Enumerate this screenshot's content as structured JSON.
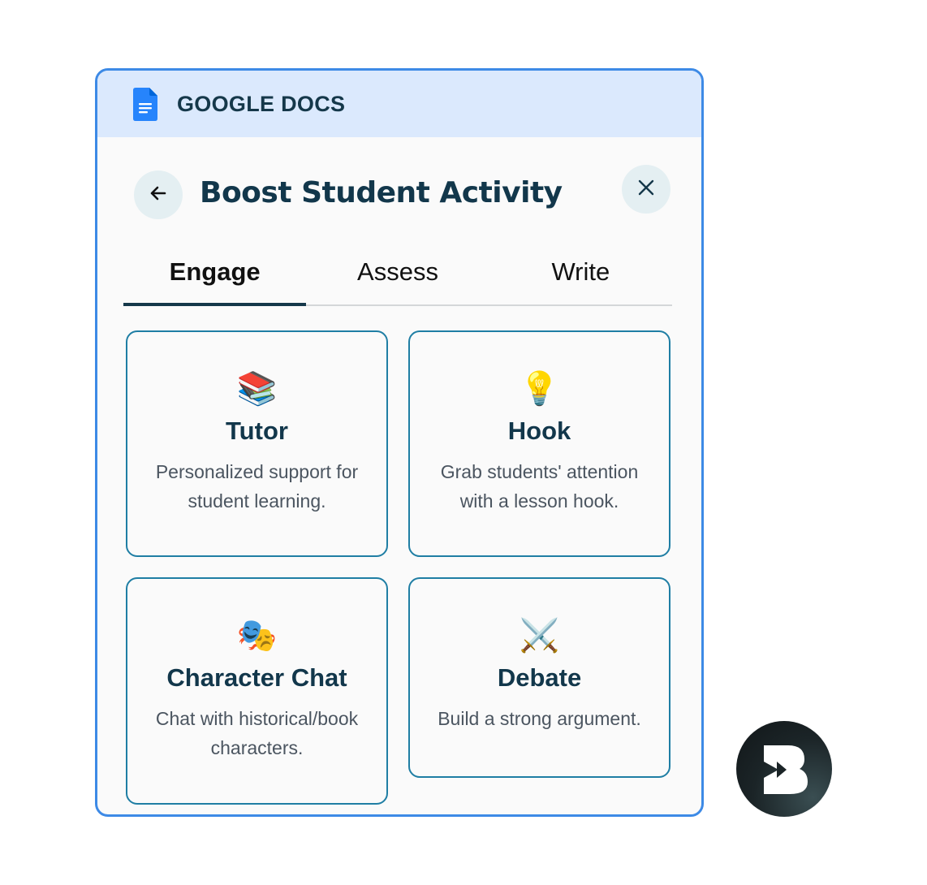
{
  "app": {
    "name": "GOOGLE DOCS",
    "icon": "google-docs-icon",
    "accent_color": "#3d8ae6",
    "header_bg": "#dbe9fd"
  },
  "page": {
    "title": "Boost Student Activity",
    "back_icon": "arrow-left-icon",
    "close_icon": "close-icon"
  },
  "tabs": [
    {
      "label": "Engage",
      "active": true
    },
    {
      "label": "Assess",
      "active": false
    },
    {
      "label": "Write",
      "active": false
    }
  ],
  "cards": [
    {
      "emoji": "📚",
      "icon": "books-icon",
      "title": "Tutor",
      "description": "Personalized support for student learning."
    },
    {
      "emoji": "💡",
      "icon": "lightbulb-icon",
      "title": "Hook",
      "description": "Grab students' attention with a lesson hook."
    },
    {
      "emoji": "🎭",
      "icon": "theater-masks-icon",
      "title": "Character Chat",
      "description": "Chat with historical/book characters."
    },
    {
      "emoji": "⚔️",
      "icon": "crossed-swords-icon",
      "title": "Debate",
      "description": "Build a strong argument."
    }
  ],
  "brand": {
    "icon": "brand-b-logo-icon"
  }
}
